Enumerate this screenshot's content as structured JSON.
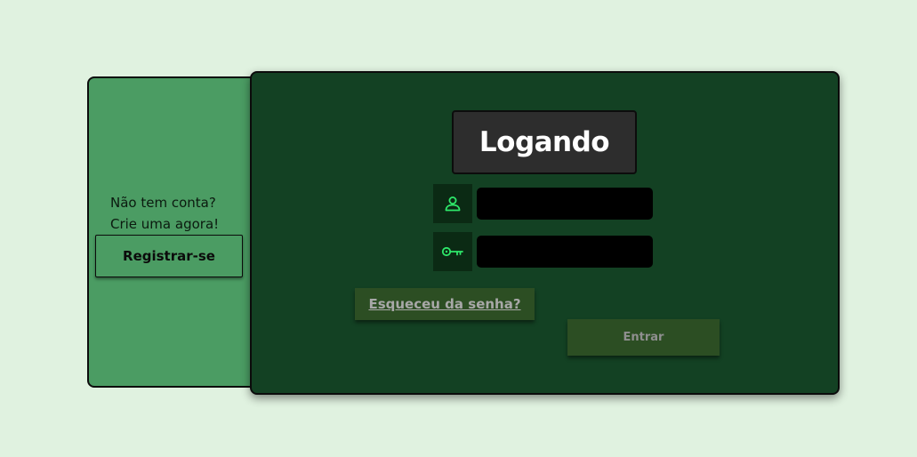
{
  "colors": {
    "background": "#e0f2e0",
    "side_panel": "#4b9c63",
    "main_card": "#134123",
    "title_box": "#2d2d2d",
    "icon_box": "#0b2a14",
    "icon_color": "#2ee86a",
    "input": "#000000",
    "button": "#2c4e23"
  },
  "side": {
    "line1": "Não tem conta?",
    "line2": "Crie uma agora!",
    "register_label": "Registrar-se"
  },
  "login": {
    "title": "Logando",
    "username": {
      "icon": "user-icon",
      "value": "",
      "placeholder": ""
    },
    "password": {
      "icon": "key-icon",
      "value": "",
      "placeholder": ""
    },
    "forgot_label": "Esqueceu da senha?",
    "submit_label": "Entrar"
  }
}
